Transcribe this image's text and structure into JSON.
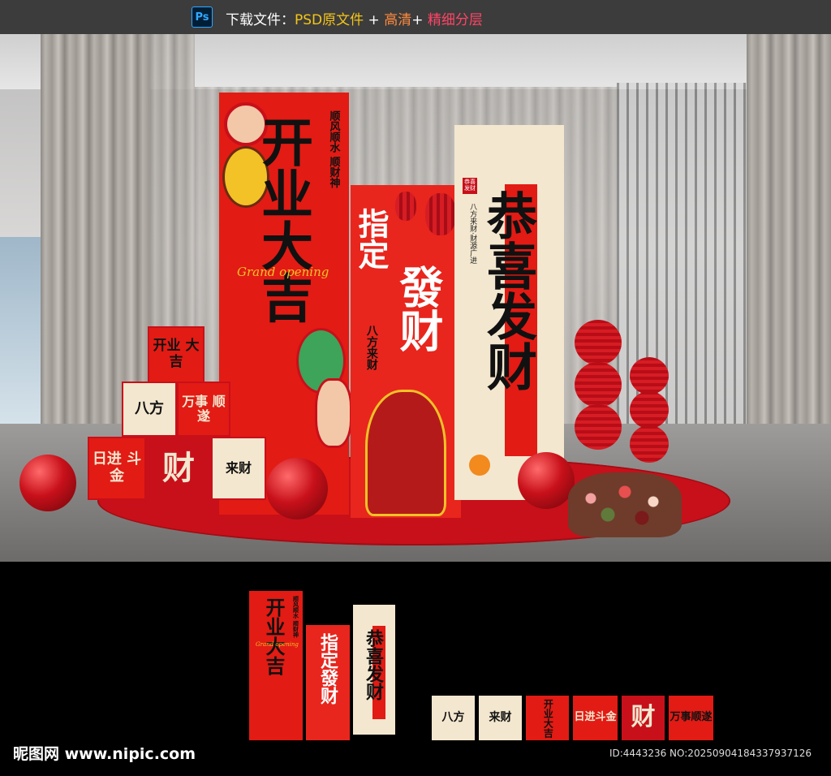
{
  "topbar": {
    "ps_label": "Ps",
    "prefix": "下载文件：",
    "psd": "PSD原文件",
    "plus1": " + ",
    "hd": "高清",
    "plus2": "+ ",
    "layers": "精细分层"
  },
  "banner_left": {
    "main_text": "开业大吉",
    "side_text": "顺风顺水 顺财神",
    "english": "Grand opening"
  },
  "banner_middle": {
    "main_text_1": "指定",
    "main_text_2": "發财",
    "side_text": "八方来财"
  },
  "banner_right": {
    "main_text": "恭喜发财",
    "side_text": "八方来财·财源广进",
    "seal_text": "恭喜发财"
  },
  "boxes": {
    "top": "开业 大吉",
    "mid_left": "八方",
    "mid_right": "万事 顺遂",
    "bottom_left": "日进 斗金",
    "bottom_mid": "财",
    "bottom_right": "来财"
  },
  "preview": {
    "thumb1_main": "开业大吉",
    "thumb1_side": "顺风顺水 顺财神",
    "thumb1_en": "Grand opening",
    "thumb2_main": "指定發财",
    "thumb3_main": "恭喜发财",
    "cubes": [
      "八方",
      "来财",
      "开业大吉",
      "日进斗金",
      "财",
      "万事顺遂"
    ]
  },
  "footer": {
    "logo": "昵图网 www.nipic.com",
    "id_text": "ID:4443236 NO:20250904184337937126"
  },
  "colors": {
    "red": "#e21b14",
    "cream": "#f3e7cf",
    "gold": "#f2c227",
    "dark": "#111111"
  }
}
